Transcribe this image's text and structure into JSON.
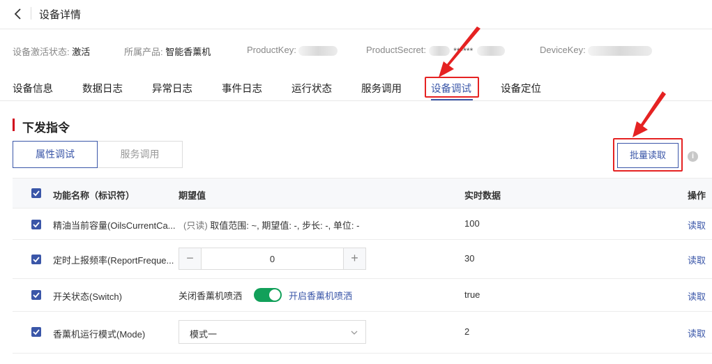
{
  "header": {
    "title": "设备详情"
  },
  "info": {
    "activation_label": "设备激活状态:",
    "activation_value": "激活",
    "product_label": "所属产品:",
    "product_value": "智能香薰机",
    "product_key_label": "ProductKey:",
    "product_secret_label": "ProductSecret:",
    "product_secret_visible": "******",
    "device_key_label": "DeviceKey:"
  },
  "tabs": [
    {
      "label": "设备信息"
    },
    {
      "label": "数据日志"
    },
    {
      "label": "异常日志"
    },
    {
      "label": "事件日志"
    },
    {
      "label": "运行状态"
    },
    {
      "label": "服务调用"
    },
    {
      "label": "设备调试"
    },
    {
      "label": "设备定位"
    }
  ],
  "section": {
    "title": "下发指令"
  },
  "mode_tabs": {
    "attribute": "属性调试",
    "service": "服务调用"
  },
  "batch_read_label": "批量读取",
  "info_icon": "i",
  "table": {
    "headers": {
      "name": "功能名称（标识符）",
      "expected": "期望值",
      "realtime": "实时数据",
      "action": "操作"
    },
    "rows": [
      {
        "name": "精油当前容量(OilsCurrentCa...",
        "readonly": "(只读)",
        "desc": "取值范围: ~,  期望值: -,  步长: -,  单位: -",
        "realtime": "100",
        "action": "读取"
      },
      {
        "name": "定时上报频率(ReportFreque...",
        "stepper_value": "0",
        "stepper_minus": "−",
        "stepper_plus": "+",
        "realtime": "30",
        "action": "读取"
      },
      {
        "name": "开关状态(Switch)",
        "off_label": "关闭香薰机喷洒",
        "on_label": "开启香薰机喷洒",
        "realtime": "true",
        "action": "读取"
      },
      {
        "name": "香薰机运行模式(Mode)",
        "select_value": "模式一",
        "realtime": "2",
        "action": "读取"
      }
    ]
  },
  "colors": {
    "accent": "#3a56a8",
    "highlight": "#e52222",
    "switch_on": "#12a05a",
    "section_bar": "#d0021b"
  }
}
